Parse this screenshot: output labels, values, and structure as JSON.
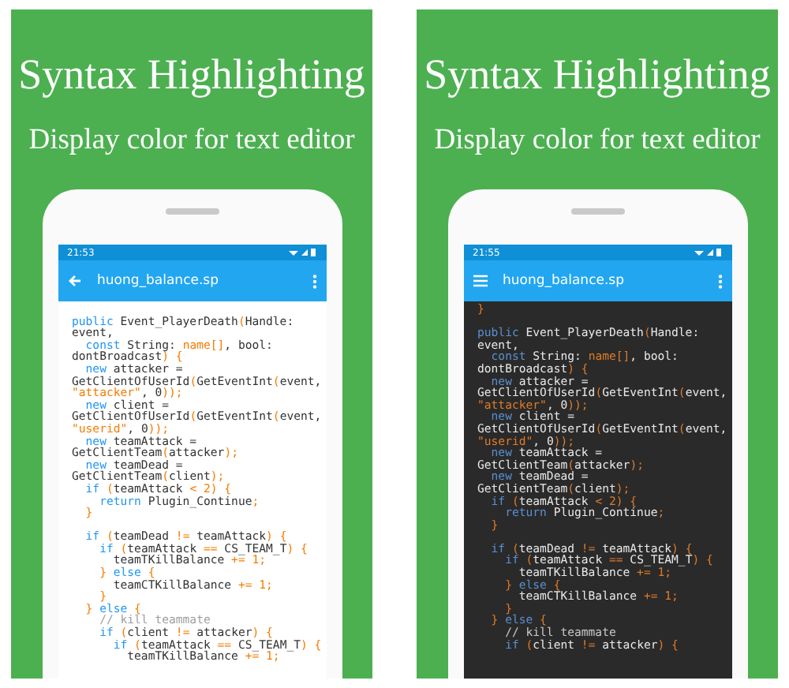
{
  "panels": [
    {
      "title": "Syntax Highlighting",
      "subtitle": "Display color for text editor",
      "phone": {
        "kind": "light",
        "status_time": "21:53",
        "nav": {
          "kind": "back"
        },
        "file_name": "huong_balance.sp",
        "lines": [
          {
            "kind": "blank"
          },
          [
            {
              "kind": "kw",
              "text": "public"
            },
            {
              "kind": "id",
              "text": " Event_PlayerDeath"
            },
            {
              "kind": "op",
              "text": "("
            },
            {
              "kind": "id",
              "text": "Handle:"
            }
          ],
          [
            {
              "kind": "id",
              "text": "event,"
            }
          ],
          [
            {
              "kind": "kw",
              "text": "  const"
            },
            {
              "kind": "id",
              "text": " String: "
            },
            {
              "kind": "op",
              "text": "name[]"
            },
            {
              "kind": "id",
              "text": ", bool:"
            }
          ],
          [
            {
              "kind": "id",
              "text": "dontBroadcast"
            },
            {
              "kind": "op",
              "text": ") {"
            }
          ],
          [
            {
              "kind": "kw",
              "text": "  new"
            },
            {
              "kind": "id",
              "text": " attacker ="
            }
          ],
          [
            {
              "kind": "id",
              "text": "GetClientOfUserId"
            },
            {
              "kind": "op",
              "text": "("
            },
            {
              "kind": "id",
              "text": "GetEventInt"
            },
            {
              "kind": "op",
              "text": "("
            },
            {
              "kind": "id",
              "text": "event,"
            }
          ],
          [
            {
              "kind": "str",
              "text": "\"attacker\""
            },
            {
              "kind": "id",
              "text": ", 0"
            },
            {
              "kind": "op",
              "text": "));"
            }
          ],
          [
            {
              "kind": "kw",
              "text": "  new"
            },
            {
              "kind": "id",
              "text": " client ="
            }
          ],
          [
            {
              "kind": "id",
              "text": "GetClientOfUserId"
            },
            {
              "kind": "op",
              "text": "("
            },
            {
              "kind": "id",
              "text": "GetEventInt"
            },
            {
              "kind": "op",
              "text": "("
            },
            {
              "kind": "id",
              "text": "event,"
            }
          ],
          [
            {
              "kind": "str",
              "text": "\"userid\""
            },
            {
              "kind": "id",
              "text": ", 0"
            },
            {
              "kind": "op",
              "text": "));"
            }
          ],
          [
            {
              "kind": "kw",
              "text": "  new"
            },
            {
              "kind": "id",
              "text": " teamAttack ="
            }
          ],
          [
            {
              "kind": "id",
              "text": "GetClientTeam"
            },
            {
              "kind": "op",
              "text": "("
            },
            {
              "kind": "id",
              "text": "attacker"
            },
            {
              "kind": "op",
              "text": ");"
            }
          ],
          [
            {
              "kind": "kw",
              "text": "  new"
            },
            {
              "kind": "id",
              "text": " teamDead ="
            }
          ],
          [
            {
              "kind": "id",
              "text": "GetClientTeam"
            },
            {
              "kind": "op",
              "text": "("
            },
            {
              "kind": "id",
              "text": "client"
            },
            {
              "kind": "op",
              "text": ");"
            }
          ],
          [
            {
              "kind": "kw",
              "text": "  if"
            },
            {
              "kind": "op",
              "text": " ("
            },
            {
              "kind": "id",
              "text": "teamAttack "
            },
            {
              "kind": "op",
              "text": "< 2) {"
            }
          ],
          [
            {
              "kind": "kw",
              "text": "    return"
            },
            {
              "kind": "id",
              "text": " Plugin_Continue"
            },
            {
              "kind": "op",
              "text": ";"
            }
          ],
          [
            {
              "kind": "op",
              "text": "  }"
            }
          ],
          {
            "kind": "blank"
          },
          [
            {
              "kind": "kw",
              "text": "  if"
            },
            {
              "kind": "op",
              "text": " ("
            },
            {
              "kind": "id",
              "text": "teamDead "
            },
            {
              "kind": "op",
              "text": "!= "
            },
            {
              "kind": "id",
              "text": "teamAttack"
            },
            {
              "kind": "op",
              "text": ") {"
            }
          ],
          [
            {
              "kind": "kw",
              "text": "    if"
            },
            {
              "kind": "op",
              "text": " ("
            },
            {
              "kind": "id",
              "text": "teamAttack "
            },
            {
              "kind": "op",
              "text": "== "
            },
            {
              "kind": "id",
              "text": "CS_TEAM_T"
            },
            {
              "kind": "op",
              "text": ") {"
            }
          ],
          [
            {
              "kind": "id",
              "text": "      teamTKillBalance "
            },
            {
              "kind": "op",
              "text": "+= 1;"
            }
          ],
          [
            {
              "kind": "op",
              "text": "    } "
            },
            {
              "kind": "kw",
              "text": "else"
            },
            {
              "kind": "op",
              "text": " {"
            }
          ],
          [
            {
              "kind": "id",
              "text": "      teamCTKillBalance "
            },
            {
              "kind": "op",
              "text": "+= 1;"
            }
          ],
          [
            {
              "kind": "op",
              "text": "    }"
            }
          ],
          [
            {
              "kind": "op",
              "text": "  } "
            },
            {
              "kind": "kw",
              "text": "else"
            },
            {
              "kind": "op",
              "text": " {"
            }
          ],
          [
            {
              "kind": "cm",
              "text": "    // kill teammate"
            }
          ],
          [
            {
              "kind": "kw",
              "text": "    if"
            },
            {
              "kind": "op",
              "text": " ("
            },
            {
              "kind": "id",
              "text": "client "
            },
            {
              "kind": "op",
              "text": "!= "
            },
            {
              "kind": "id",
              "text": "attacker"
            },
            {
              "kind": "op",
              "text": ") {"
            }
          ],
          [
            {
              "kind": "kw",
              "text": "      if"
            },
            {
              "kind": "op",
              "text": " ("
            },
            {
              "kind": "id",
              "text": "teamAttack "
            },
            {
              "kind": "op",
              "text": "== "
            },
            {
              "kind": "id",
              "text": "CS_TEAM_T"
            },
            {
              "kind": "op",
              "text": ") {"
            }
          ],
          [
            {
              "kind": "id",
              "text": "        teamTKillBalance "
            },
            {
              "kind": "op",
              "text": "+= 1;"
            }
          ]
        ]
      }
    },
    {
      "title": "Syntax Highlighting",
      "subtitle": "Display color for text editor",
      "phone": {
        "kind": "dark",
        "status_time": "21:55",
        "nav": {
          "kind": "menu"
        },
        "file_name": "huong_balance.sp",
        "lines": [
          [
            {
              "kind": "op",
              "text": "}"
            }
          ],
          {
            "kind": "blank"
          },
          [
            {
              "kind": "kw",
              "text": "public"
            },
            {
              "kind": "id",
              "text": " Event_PlayerDeath"
            },
            {
              "kind": "op",
              "text": "("
            },
            {
              "kind": "id",
              "text": "Handle:"
            }
          ],
          [
            {
              "kind": "id",
              "text": "event,"
            }
          ],
          [
            {
              "kind": "kw",
              "text": "  const"
            },
            {
              "kind": "id",
              "text": " String: "
            },
            {
              "kind": "op",
              "text": "name[]"
            },
            {
              "kind": "id",
              "text": ", bool:"
            }
          ],
          [
            {
              "kind": "id",
              "text": "dontBroadcast"
            },
            {
              "kind": "op",
              "text": ") {"
            }
          ],
          [
            {
              "kind": "kw",
              "text": "  new"
            },
            {
              "kind": "id",
              "text": " attacker ="
            }
          ],
          [
            {
              "kind": "id",
              "text": "GetClientOfUserId"
            },
            {
              "kind": "op",
              "text": "("
            },
            {
              "kind": "id",
              "text": "GetEventInt"
            },
            {
              "kind": "op",
              "text": "("
            },
            {
              "kind": "id",
              "text": "event,"
            }
          ],
          [
            {
              "kind": "str",
              "text": "\"attacker\""
            },
            {
              "kind": "id",
              "text": ", 0"
            },
            {
              "kind": "op",
              "text": "));"
            }
          ],
          [
            {
              "kind": "kw",
              "text": "  new"
            },
            {
              "kind": "id",
              "text": " client ="
            }
          ],
          [
            {
              "kind": "id",
              "text": "GetClientOfUserId"
            },
            {
              "kind": "op",
              "text": "("
            },
            {
              "kind": "id",
              "text": "GetEventInt"
            },
            {
              "kind": "op",
              "text": "("
            },
            {
              "kind": "id",
              "text": "event,"
            }
          ],
          [
            {
              "kind": "str",
              "text": "\"userid\""
            },
            {
              "kind": "id",
              "text": ", 0"
            },
            {
              "kind": "op",
              "text": "));"
            }
          ],
          [
            {
              "kind": "kw",
              "text": "  new"
            },
            {
              "kind": "id",
              "text": " teamAttack ="
            }
          ],
          [
            {
              "kind": "id",
              "text": "GetClientTeam"
            },
            {
              "kind": "op",
              "text": "("
            },
            {
              "kind": "id",
              "text": "attacker"
            },
            {
              "kind": "op",
              "text": ");"
            }
          ],
          [
            {
              "kind": "kw",
              "text": "  new"
            },
            {
              "kind": "id",
              "text": " teamDead ="
            }
          ],
          [
            {
              "kind": "id",
              "text": "GetClientTeam"
            },
            {
              "kind": "op",
              "text": "("
            },
            {
              "kind": "id",
              "text": "client"
            },
            {
              "kind": "op",
              "text": ");"
            }
          ],
          [
            {
              "kind": "kw",
              "text": "  if"
            },
            {
              "kind": "op",
              "text": " ("
            },
            {
              "kind": "id",
              "text": "teamAttack "
            },
            {
              "kind": "op",
              "text": "< 2) {"
            }
          ],
          [
            {
              "kind": "kw",
              "text": "    return"
            },
            {
              "kind": "id",
              "text": " Plugin_Continue"
            },
            {
              "kind": "op",
              "text": ";"
            }
          ],
          [
            {
              "kind": "op",
              "text": "  }"
            }
          ],
          {
            "kind": "blank"
          },
          [
            {
              "kind": "kw",
              "text": "  if"
            },
            {
              "kind": "op",
              "text": " ("
            },
            {
              "kind": "id",
              "text": "teamDead "
            },
            {
              "kind": "op",
              "text": "!= "
            },
            {
              "kind": "id",
              "text": "teamAttack"
            },
            {
              "kind": "op",
              "text": ") {"
            }
          ],
          [
            {
              "kind": "kw",
              "text": "    if"
            },
            {
              "kind": "op",
              "text": " ("
            },
            {
              "kind": "id",
              "text": "teamAttack "
            },
            {
              "kind": "op",
              "text": "== "
            },
            {
              "kind": "id",
              "text": "CS_TEAM_T"
            },
            {
              "kind": "op",
              "text": ") {"
            }
          ],
          [
            {
              "kind": "id",
              "text": "      teamTKillBalance "
            },
            {
              "kind": "op",
              "text": "+= 1;"
            }
          ],
          [
            {
              "kind": "op",
              "text": "    } "
            },
            {
              "kind": "kw",
              "text": "else"
            },
            {
              "kind": "op",
              "text": " {"
            }
          ],
          [
            {
              "kind": "id",
              "text": "      teamCTKillBalance "
            },
            {
              "kind": "op",
              "text": "+= 1;"
            }
          ],
          [
            {
              "kind": "op",
              "text": "    }"
            }
          ],
          [
            {
              "kind": "op",
              "text": "  } "
            },
            {
              "kind": "kw",
              "text": "else"
            },
            {
              "kind": "op",
              "text": " {"
            }
          ],
          [
            {
              "kind": "cm",
              "text": "    // kill teammate"
            }
          ],
          [
            {
              "kind": "kw",
              "text": "    if"
            },
            {
              "kind": "op",
              "text": " ("
            },
            {
              "kind": "id",
              "text": "client "
            },
            {
              "kind": "op",
              "text": "!= "
            },
            {
              "kind": "id",
              "text": "attacker"
            },
            {
              "kind": "op",
              "text": ") {"
            }
          ]
        ]
      }
    }
  ]
}
